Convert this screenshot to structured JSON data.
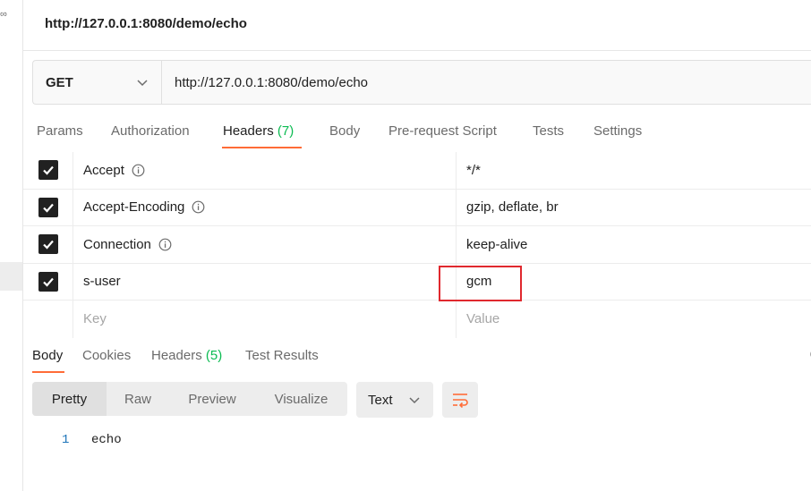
{
  "colors": {
    "accent": "#ff6c37",
    "count_green": "#0cbb52",
    "highlight_red": "#e0282e",
    "line_number_blue": "#1b73b8"
  },
  "rail": {
    "glyph": "∞"
  },
  "request": {
    "title": "http://127.0.0.1:8080/demo/echo",
    "method": "GET",
    "url": "http://127.0.0.1:8080/demo/echo"
  },
  "req_tabs": {
    "params": "Params",
    "authorization": "Authorization",
    "headers_label": "Headers",
    "headers_count": "(7)",
    "body": "Body",
    "prerequest": "Pre-request Script",
    "tests": "Tests",
    "settings": "Settings"
  },
  "headers": [
    {
      "key": "Accept",
      "value": "*/*",
      "checked": true,
      "info_icon": "info-icon"
    },
    {
      "key": "Accept-Encoding",
      "value": "gzip, deflate, br",
      "checked": true,
      "info_icon": "info-icon"
    },
    {
      "key": "Connection",
      "value": "keep-alive",
      "checked": true,
      "info_icon": "info-icon"
    },
    {
      "key": "s-user",
      "value": "gcm",
      "checked": true
    }
  ],
  "new_header": {
    "key_placeholder": "Key",
    "value_placeholder": "Value"
  },
  "resp_tabs": {
    "body": "Body",
    "cookies": "Cookies",
    "headers_label": "Headers",
    "headers_count": "(5)",
    "test_results": "Test Results"
  },
  "view_modes": [
    "Pretty",
    "Raw",
    "Preview",
    "Visualize"
  ],
  "format": "Text",
  "response": {
    "line_number": "1",
    "line_text": "echo"
  }
}
